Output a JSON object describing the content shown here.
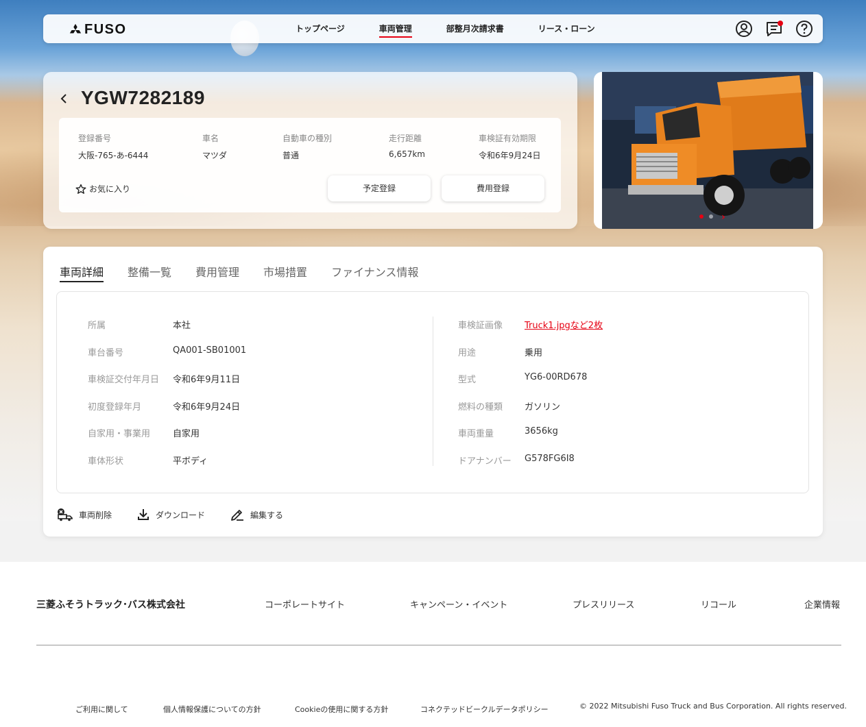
{
  "header": {
    "logo_text": "FUSO",
    "nav": [
      {
        "label": "トップページ"
      },
      {
        "label": "車両管理",
        "active": true
      },
      {
        "label": "部整月次請求書"
      },
      {
        "label": "リース・ローン"
      }
    ],
    "icons": [
      "user-icon",
      "message-icon",
      "help-icon"
    ],
    "accent_color": "#e60012"
  },
  "vehicle": {
    "id": "YGW7282189",
    "fields": [
      {
        "label": "登録番号",
        "value": "大阪-765-あ-6444"
      },
      {
        "label": "車名",
        "value": "マツダ"
      },
      {
        "label": "自動車の種別",
        "value": "普通"
      },
      {
        "label": "走行距離",
        "value": "6,657km"
      },
      {
        "label": "車検証有効期限",
        "value": "令和6年9月24日"
      }
    ],
    "favorite_label": "お気に入り",
    "schedule_button": "予定登録",
    "cost_button": "費用登録"
  },
  "tabs": [
    {
      "label": "車両詳細",
      "active": true
    },
    {
      "label": "整備一覧"
    },
    {
      "label": "費用管理"
    },
    {
      "label": "市場措置"
    },
    {
      "label": "ファイナンス情報"
    }
  ],
  "details": {
    "left": [
      {
        "key": "所属",
        "value": "本社"
      },
      {
        "key": "車台番号",
        "value": "QA001-SB01001"
      },
      {
        "key": "車検証交付年月日",
        "value": "令和6年9月11日"
      },
      {
        "key": "初度登録年月",
        "value": "令和6年9月24日"
      },
      {
        "key": "自家用・事業用",
        "value": "自家用"
      },
      {
        "key": "車体形状",
        "value": "平ボディ"
      }
    ],
    "right": [
      {
        "key": "車検証画像",
        "value": "Truck1.jpgなど2枚",
        "link": true
      },
      {
        "key": "用途",
        "value": "乗用"
      },
      {
        "key": "型式",
        "value": "YG6-00RD678"
      },
      {
        "key": "燃料の種類",
        "value": "ガソリン"
      },
      {
        "key": "車両重量",
        "value": "3656kg"
      },
      {
        "key": "ドアナンバー",
        "value": "G578FG6I8"
      }
    ]
  },
  "actions": {
    "delete": "車両削除",
    "download": "ダウンロード",
    "edit": "編集する"
  },
  "footer": {
    "company": "三菱ふそうトラック･バス株式会社",
    "links": [
      "コーポレートサイト",
      "キャンペーン・イベント",
      "プレスリリース",
      "リコール",
      "企業情報"
    ],
    "bottom_links": [
      "ご利用に関して",
      "個人情報保護についての方針",
      "Cookieの使用に関する方針",
      "コネクテッドビークルデータポリシー"
    ],
    "copyright": "© 2022 Mitsubishi Fuso Truck and Bus Corporation. All rights reserved."
  }
}
